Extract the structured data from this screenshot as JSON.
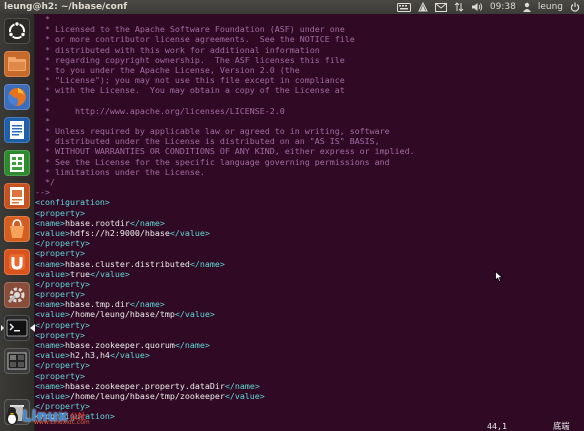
{
  "window": {
    "title": "leung@h2: ~/hbase/conf"
  },
  "tray": {
    "time": "09:38",
    "user": "leung"
  },
  "launcher": {
    "items": [
      "dash",
      "files",
      "firefox",
      "writer",
      "calc",
      "impress",
      "software-center",
      "ubuntu-one",
      "settings",
      "terminal",
      "workspaces",
      "trash"
    ]
  },
  "editor": {
    "lines": [
      {
        "t": "  *",
        "c": "com"
      },
      {
        "t": "  * Licensed to the Apache Software Foundation (ASF) under one",
        "c": "com"
      },
      {
        "t": "  * or more contributor license agreements.  See the NOTICE file",
        "c": "com"
      },
      {
        "t": "  * distributed with this work for additional information",
        "c": "com"
      },
      {
        "t": "  * regarding copyright ownership.  The ASF licenses this file",
        "c": "com"
      },
      {
        "t": "  * to you under the Apache License, Version 2.0 (the",
        "c": "com"
      },
      {
        "t": "  * \"License\"); you may not use this file except in compliance",
        "c": "com"
      },
      {
        "t": "  * with the License.  You may obtain a copy of the License at",
        "c": "com"
      },
      {
        "t": "  *",
        "c": "com"
      },
      {
        "t": "  *     http://www.apache.org/licenses/LICENSE-2.0",
        "c": "com"
      },
      {
        "t": "  *",
        "c": "com"
      },
      {
        "t": "  * Unless required by applicable law or agreed to in writing, software",
        "c": "com"
      },
      {
        "t": "  * distributed under the License is distributed on an \"AS IS\" BASIS,",
        "c": "com"
      },
      {
        "t": "  * WITHOUT WARRANTIES OR CONDITIONS OF ANY KIND, either express or implied.",
        "c": "com"
      },
      {
        "t": "  * See the License for the specific language governing permissions and",
        "c": "com"
      },
      {
        "t": "  * limitations under the License.",
        "c": "com"
      },
      {
        "t": "  */",
        "c": "com"
      },
      {
        "t": "-->",
        "c": "com"
      },
      {
        "t": "<configuration>",
        "c": "tag"
      },
      {
        "t": "<property>",
        "c": "tag"
      },
      {
        "parts": [
          [
            "<name>",
            "tag"
          ],
          [
            "hbase.rootdir",
            "val"
          ],
          [
            "</name>",
            "tag"
          ]
        ]
      },
      {
        "parts": [
          [
            "<value>",
            "tag"
          ],
          [
            "hdfs://h2:9000/hbase",
            "val"
          ],
          [
            "</value>",
            "tag"
          ]
        ]
      },
      {
        "t": "</property>",
        "c": "tag"
      },
      {
        "t": "<property>",
        "c": "tag"
      },
      {
        "parts": [
          [
            "<name>",
            "tag"
          ],
          [
            "hbase.cluster.distributed",
            "val"
          ],
          [
            "</name>",
            "tag"
          ]
        ]
      },
      {
        "parts": [
          [
            "<value>",
            "tag"
          ],
          [
            "true",
            "val"
          ],
          [
            "</value>",
            "tag"
          ]
        ]
      },
      {
        "t": "</property>",
        "c": "tag"
      },
      {
        "t": "<property>",
        "c": "tag"
      },
      {
        "parts": [
          [
            "<name>",
            "tag"
          ],
          [
            "hbase.tmp.dir",
            "val"
          ],
          [
            "</name>",
            "tag"
          ]
        ]
      },
      {
        "parts": [
          [
            "<value>",
            "tag"
          ],
          [
            "/home/leung/hbase/tmp",
            "val"
          ],
          [
            "</value>",
            "tag"
          ]
        ]
      },
      {
        "t": "</property>",
        "c": "tag"
      },
      {
        "t": "<property>",
        "c": "tag"
      },
      {
        "parts": [
          [
            "<name>",
            "tag"
          ],
          [
            "hbase.zookeeper.quorum",
            "val"
          ],
          [
            "</name>",
            "tag"
          ]
        ]
      },
      {
        "parts": [
          [
            "<value>",
            "tag"
          ],
          [
            "h2,h3,h4",
            "val"
          ],
          [
            "</value>",
            "tag"
          ]
        ]
      },
      {
        "t": "</property>",
        "c": "tag"
      },
      {
        "t": "<property>",
        "c": "tag"
      },
      {
        "parts": [
          [
            "<name>",
            "tag"
          ],
          [
            "hbase.zookeeper.property.dataDir",
            "val"
          ],
          [
            "</name>",
            "tag"
          ]
        ]
      },
      {
        "parts": [
          [
            "<value>",
            "tag"
          ],
          [
            "/home/leung/hbase/tmp/zookeeper",
            "val"
          ],
          [
            "</value>",
            "tag"
          ]
        ]
      },
      {
        "t": "</property>",
        "c": "tag"
      },
      {
        "t": "</configuration>",
        "c": "tag"
      }
    ]
  },
  "status": {
    "position": "44,1",
    "scroll": "底端"
  },
  "watermark": {
    "brand": "Linux",
    "cn": "公社",
    "url": "www.Linuxidc.com"
  }
}
